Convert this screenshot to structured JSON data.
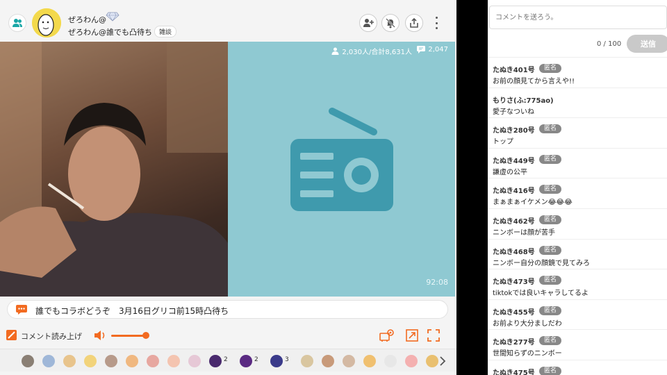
{
  "stream": {
    "owner_name": "ぜろわん@",
    "title": "ぜろわん@誰でも凸待ち",
    "tag": "雑談",
    "viewers": "2,030人/合計8,631人",
    "comment_count": "2,047",
    "elapsed": "92:08",
    "telop": "誰でもコラボどうぞ　3月16日グリコ前15時凸待ち",
    "read_aloud_label": "コメント読み上げ",
    "volume": 0.9
  },
  "items": [
    {
      "color": "#8a7f74",
      "count": ""
    },
    {
      "color": "#9fb7d8",
      "count": ""
    },
    {
      "color": "#e8c48c",
      "count": ""
    },
    {
      "color": "#f2d37a",
      "count": ""
    },
    {
      "color": "#b79a8a",
      "count": ""
    },
    {
      "color": "#f0b880",
      "count": ""
    },
    {
      "color": "#e7a7a0",
      "count": ""
    },
    {
      "color": "#f4c4b0",
      "count": ""
    },
    {
      "color": "#e6c8d6",
      "count": ""
    },
    {
      "color": "#4a2a6e",
      "count": "2"
    },
    {
      "color": "#5a2a82",
      "count": "2"
    },
    {
      "color": "#3a3a8a",
      "count": "3"
    },
    {
      "color": "#d9c6a0",
      "count": ""
    },
    {
      "color": "#c89a7a",
      "count": ""
    },
    {
      "color": "#d4b9a3",
      "count": ""
    },
    {
      "color": "#f0c070",
      "count": ""
    },
    {
      "color": "#e7e7e7",
      "count": ""
    },
    {
      "color": "#f4b0b0",
      "count": ""
    },
    {
      "color": "#e9c070",
      "count": ""
    }
  ],
  "side": {
    "placeholder": "コメントを送ろう。",
    "char_count": "0 / 100",
    "send_label": "送信",
    "comments": [
      {
        "name": "たぬき401号",
        "badge": "匿名",
        "text": "お前の顔見てから言えや!!"
      },
      {
        "name": "もりさ(ふ:775ao)",
        "badge": "",
        "text": "愛子なついね"
      },
      {
        "name": "たぬき280号",
        "badge": "匿名",
        "text": "トップ"
      },
      {
        "name": "たぬき449号",
        "badge": "匿名",
        "text": "謙虚の公平"
      },
      {
        "name": "たぬき416号",
        "badge": "匿名",
        "text": "まぁまぁイケメン😂😂😂"
      },
      {
        "name": "たぬき462号",
        "badge": "匿名",
        "text": "ニンボーは顔が苦手"
      },
      {
        "name": "たぬき468号",
        "badge": "匿名",
        "text": "ニンボー自分の顔鏡で見てみろ"
      },
      {
        "name": "たぬき473号",
        "badge": "匿名",
        "text": "tiktokでは良いキャラしてるよ"
      },
      {
        "name": "たぬき455号",
        "badge": "匿名",
        "text": "お前より大分ましだわ"
      },
      {
        "name": "たぬき277号",
        "badge": "匿名",
        "text": "世間知らずのニンボー"
      },
      {
        "name": "たぬき475号",
        "badge": "匿名",
        "text": ""
      }
    ]
  }
}
